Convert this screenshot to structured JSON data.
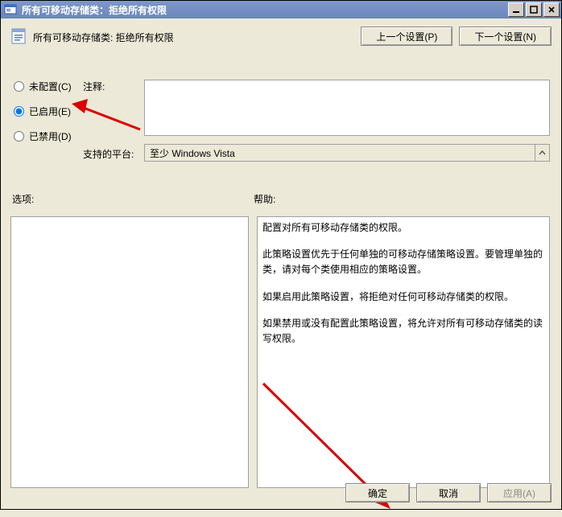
{
  "title": "所有可移动存储类：拒绝所有权限",
  "subtitle": "所有可移动存储类: 拒绝所有权限",
  "nav": {
    "prev": "上一个设置(P)",
    "next": "下一个设置(N)"
  },
  "radios": {
    "notconfigured": "未配置(C)",
    "enabled": "已启用(E)",
    "disabled": "已禁用(D)",
    "selected": "enabled"
  },
  "labels": {
    "comment": "注释:",
    "platform": "支持的平台:",
    "options": "选项:",
    "help": "帮助:"
  },
  "comment_value": "",
  "platform_value": "至少 Windows Vista",
  "options_value": "",
  "help": {
    "p1": "配置对所有可移动存储类的权限。",
    "p2": "此策略设置优先于任何单独的可移动存储策略设置。要管理单独的类，请对每个类使用相应的策略设置。",
    "p3": "如果启用此策略设置，将拒绝对任何可移动存储类的权限。",
    "p4": "如果禁用或没有配置此策略设置，将允许对所有可移动存储类的读写权限。"
  },
  "buttons": {
    "ok": "确定",
    "cancel": "取消",
    "apply": "应用(A)"
  }
}
